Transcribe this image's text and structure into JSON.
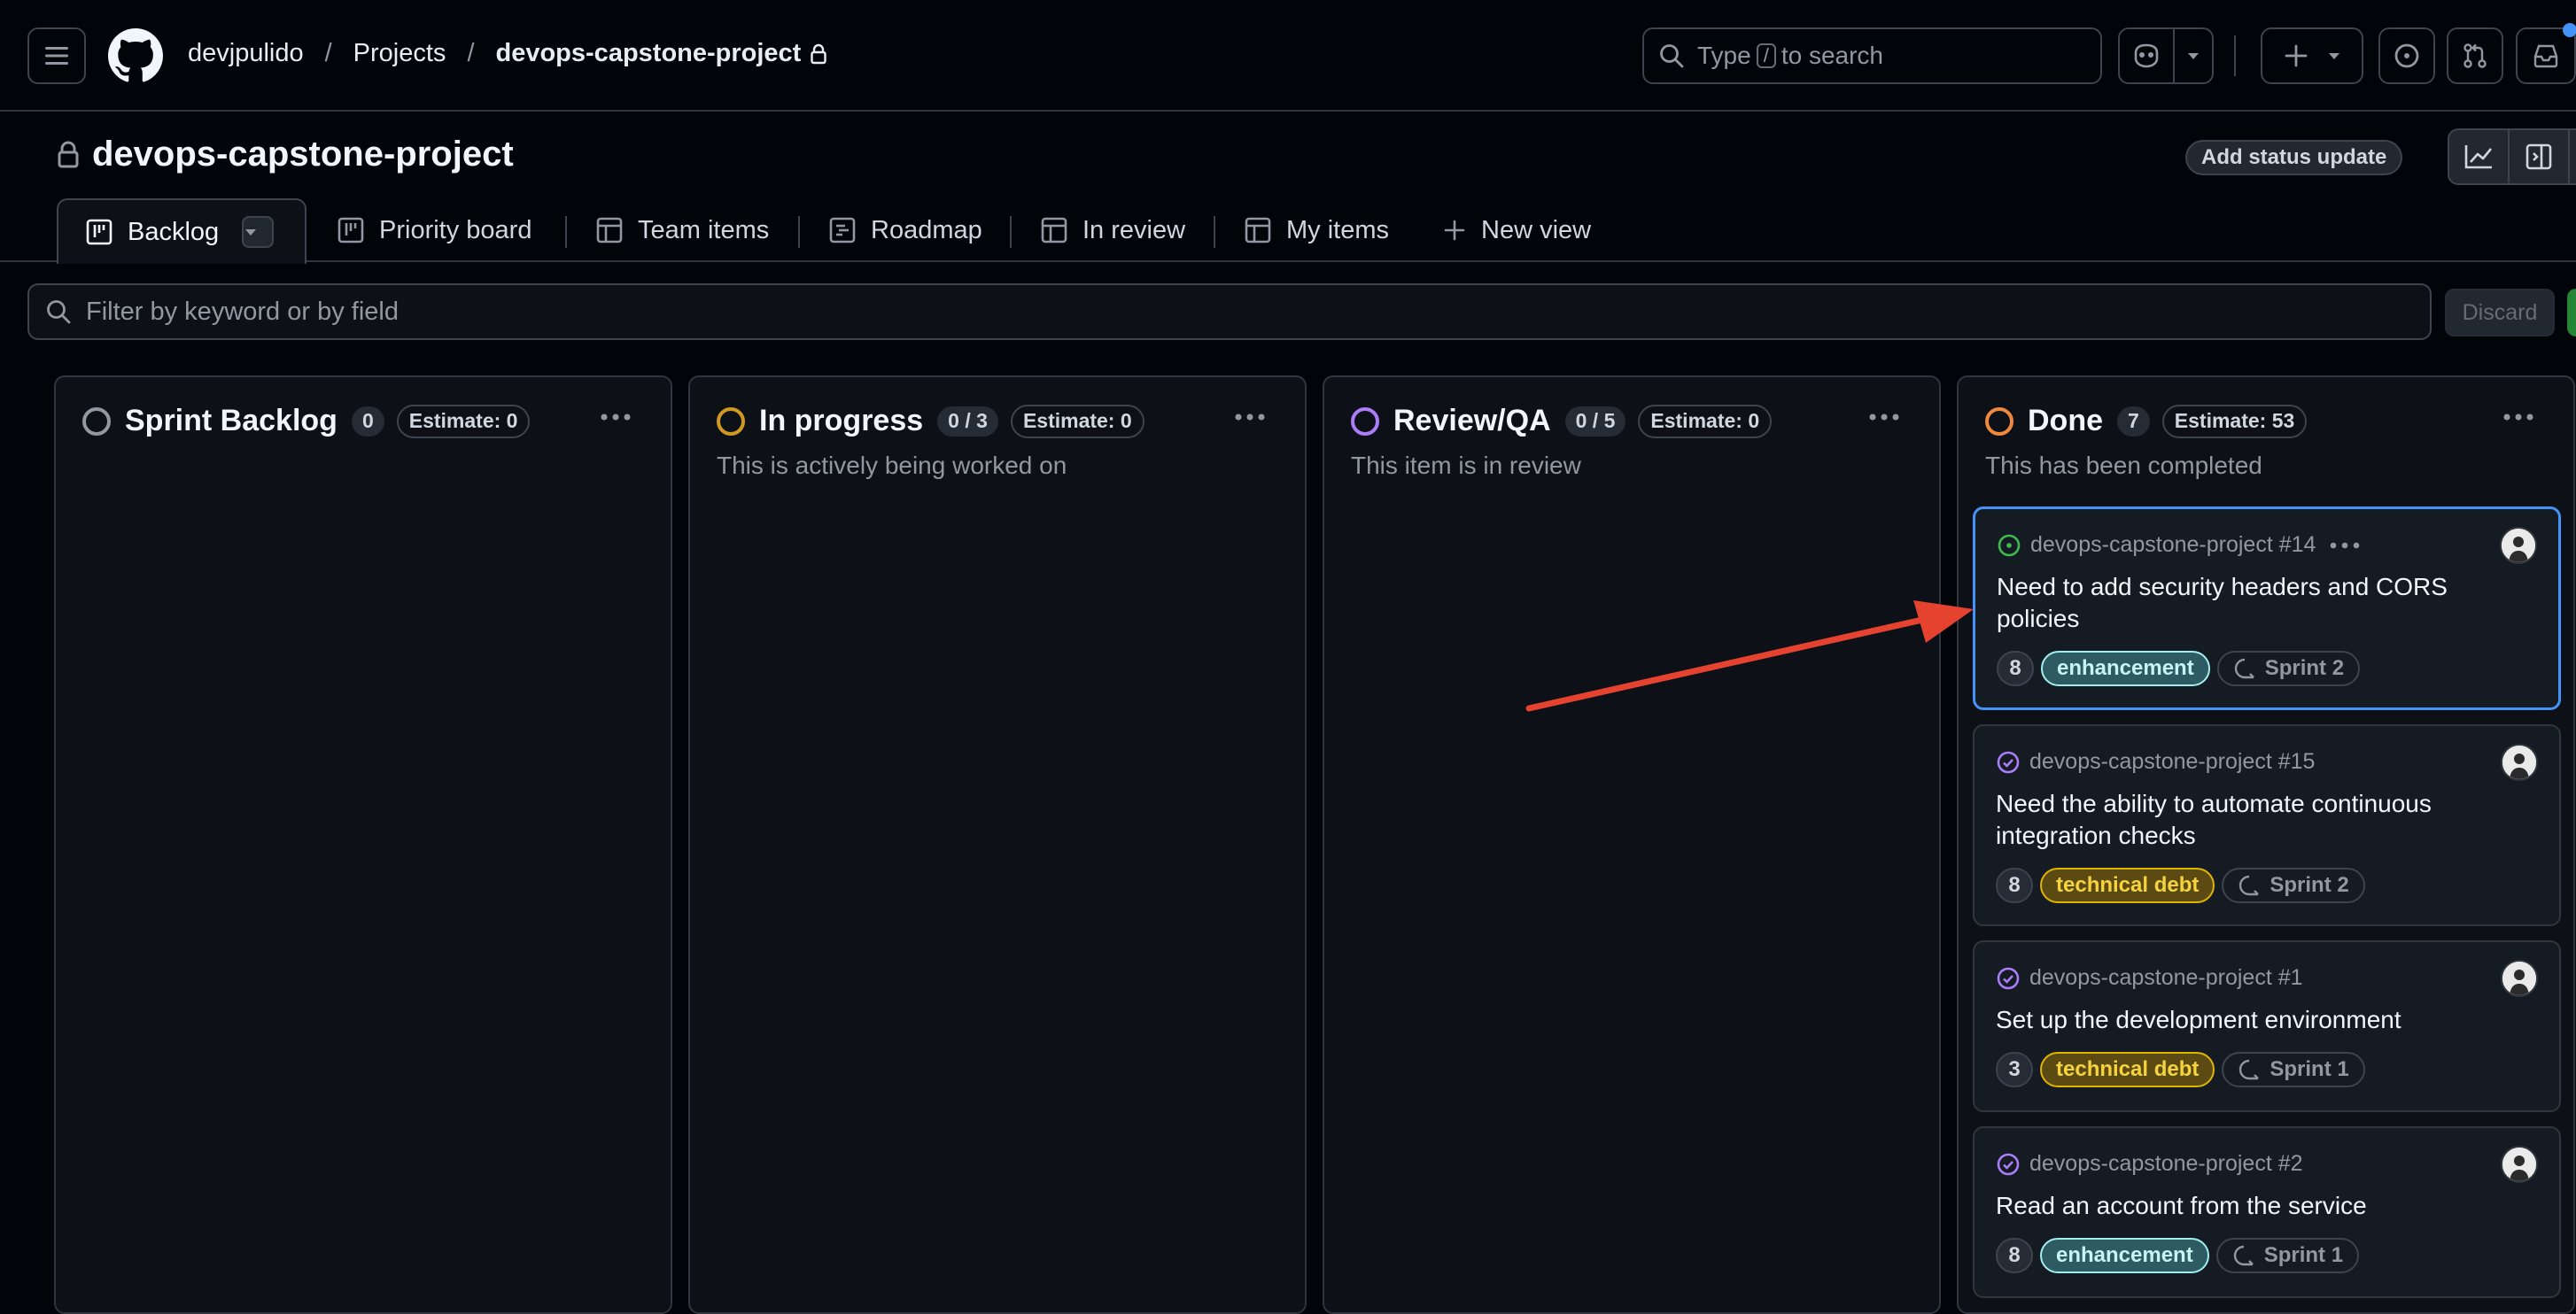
{
  "header": {
    "user": "devjpulido",
    "projects": "Projects",
    "project_name": "devops-capstone-project",
    "search_prefix": "Type",
    "search_key": "/",
    "search_suffix": "to search"
  },
  "project": {
    "title": "devops-capstone-project",
    "status_update_button": "Add status update"
  },
  "views": [
    {
      "label": "Backlog",
      "icon": "board-icon",
      "active": true
    },
    {
      "label": "Priority board",
      "icon": "board-icon"
    },
    {
      "label": "Team items",
      "icon": "table-icon"
    },
    {
      "label": "Roadmap",
      "icon": "roadmap-icon"
    },
    {
      "label": "In review",
      "icon": "table-icon"
    },
    {
      "label": "My items",
      "icon": "table-icon"
    },
    {
      "label": "New view",
      "icon": "plus-icon"
    }
  ],
  "filter": {
    "placeholder": "Filter by keyword or by field",
    "discard_label": "Discard"
  },
  "columns": [
    {
      "title": "Sprint Backlog",
      "count": "0",
      "estimate": "Estimate: 0",
      "description": "",
      "color": "#9198a1"
    },
    {
      "title": "In progress",
      "count": "0 / 3",
      "estimate": "Estimate: 0",
      "description": "This is actively being worked on",
      "color": "#d29922"
    },
    {
      "title": "Review/QA",
      "count": "0 / 5",
      "estimate": "Estimate: 0",
      "description": "This item is in review",
      "color": "#ab7df8"
    },
    {
      "title": "Done",
      "count": "7",
      "estimate": "Estimate: 53",
      "description": "This has been completed",
      "color": "#f0883e"
    }
  ],
  "cards": [
    {
      "ref": "devops-capstone-project #14",
      "title": "Need to add security headers and CORS policies",
      "estimate": "8",
      "label": "enhancement",
      "sprint": "Sprint 2",
      "state": "open"
    },
    {
      "ref": "devops-capstone-project #15",
      "title": "Need the ability to automate continuous integration checks",
      "estimate": "8",
      "label": "technical debt",
      "sprint": "Sprint 2",
      "state": "closed"
    },
    {
      "ref": "devops-capstone-project #1",
      "title": "Set up the development environment",
      "estimate": "3",
      "label": "technical debt",
      "sprint": "Sprint 1",
      "state": "closed"
    },
    {
      "ref": "devops-capstone-project #2",
      "title": "Read an account from the service",
      "estimate": "8",
      "label": "enhancement",
      "sprint": "Sprint 1",
      "state": "closed"
    }
  ],
  "colors": {
    "accent": "#4493f8",
    "background": "#010409",
    "annotation_arrow": "#e5432f"
  }
}
